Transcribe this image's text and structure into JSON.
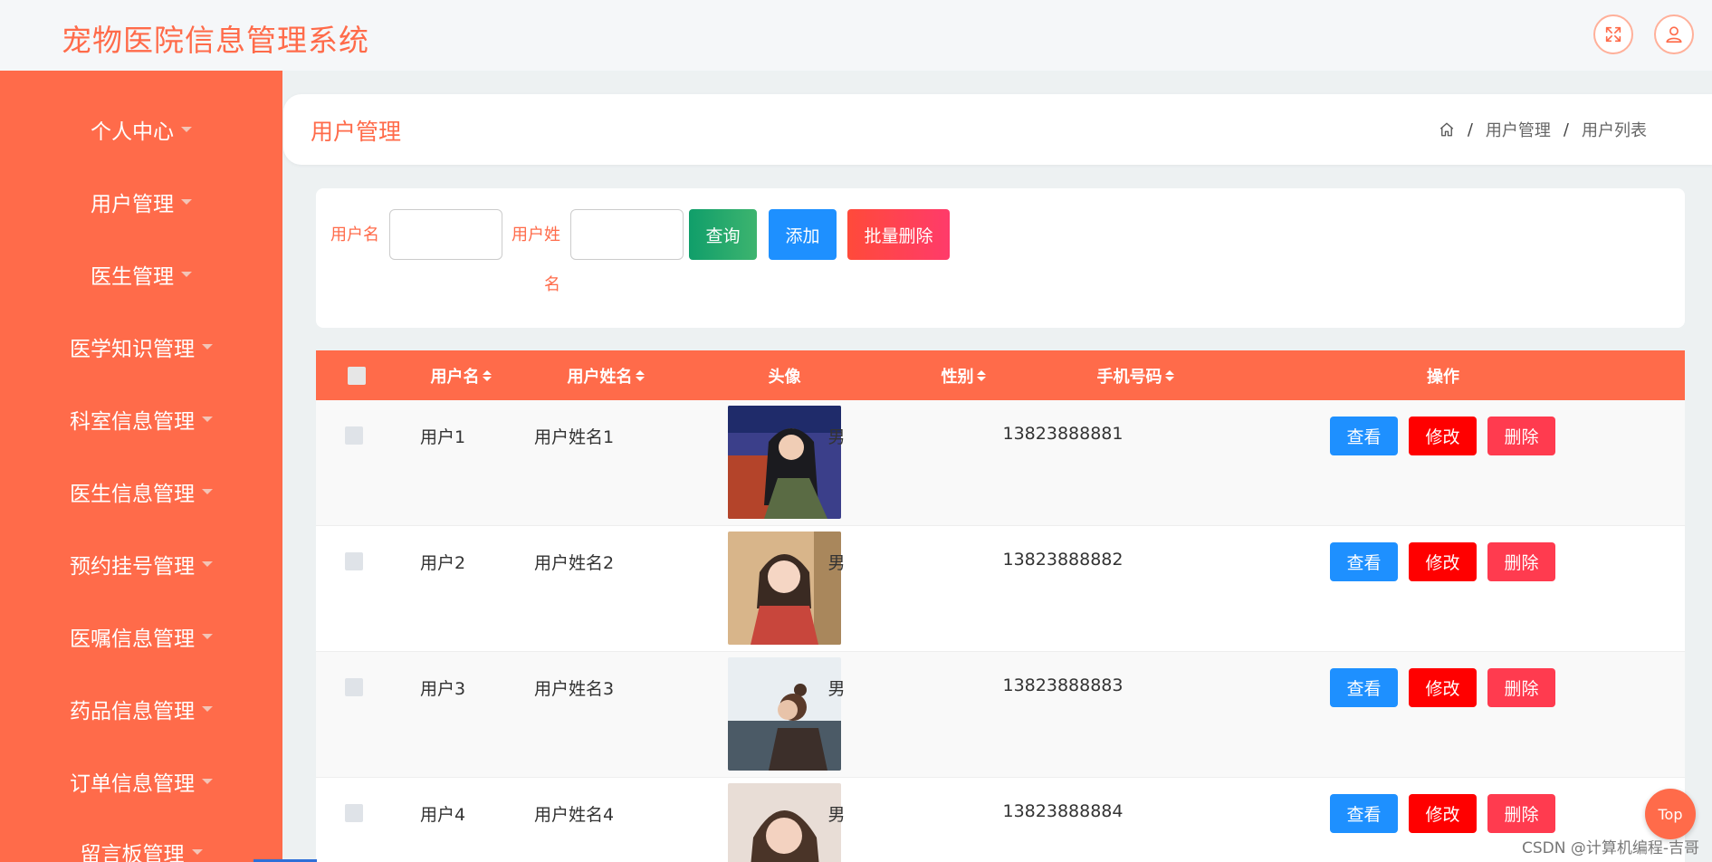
{
  "app": {
    "title": "宠物医院信息管理系统"
  },
  "header_icons": [
    "fullscreen-icon",
    "user-icon"
  ],
  "sidebar": {
    "items": [
      {
        "label": "个人中心"
      },
      {
        "label": "用户管理"
      },
      {
        "label": "医生管理"
      },
      {
        "label": "医学知识管理"
      },
      {
        "label": "科室信息管理"
      },
      {
        "label": "医生信息管理"
      },
      {
        "label": "预约挂号管理"
      },
      {
        "label": "医嘱信息管理"
      },
      {
        "label": "药品信息管理"
      },
      {
        "label": "订单信息管理"
      },
      {
        "label": "留言板管理"
      }
    ]
  },
  "page": {
    "title": "用户管理",
    "breadcrumb": [
      "用户管理",
      "用户列表"
    ]
  },
  "search": {
    "username_label": "用户名",
    "realname_label_line1": "用户姓",
    "realname_label_line2": "名",
    "username_value": "",
    "realname_value": "",
    "query_button": "查询",
    "add_button": "添加",
    "batch_delete_button": "批量删除"
  },
  "table": {
    "headers": {
      "username": "用户名",
      "realname": "用户姓名",
      "avatar": "头像",
      "gender": "性别",
      "phone": "手机号码",
      "actions": "操作"
    },
    "action_labels": {
      "view": "查看",
      "edit": "修改",
      "delete": "删除"
    },
    "rows": [
      {
        "username": "用户1",
        "realname": "用户姓名1",
        "gender": "男",
        "phone": "13823888881"
      },
      {
        "username": "用户2",
        "realname": "用户姓名2",
        "gender": "男",
        "phone": "13823888882"
      },
      {
        "username": "用户3",
        "realname": "用户姓名3",
        "gender": "男",
        "phone": "13823888883"
      },
      {
        "username": "用户4",
        "realname": "用户姓名4",
        "gender": "男",
        "phone": "13823888884"
      }
    ]
  },
  "colors": {
    "accent": "#ff6b4a",
    "view_button": "#1e90ff",
    "edit_button": "#ff0000",
    "delete_button": "#ff3b4f",
    "query_button": "#1e9e6a",
    "add_button": "#1e90ff",
    "batch_delete_button": "#ff4060"
  },
  "back_to_top": "Top",
  "watermark": "CSDN @计算机编程-吉哥"
}
